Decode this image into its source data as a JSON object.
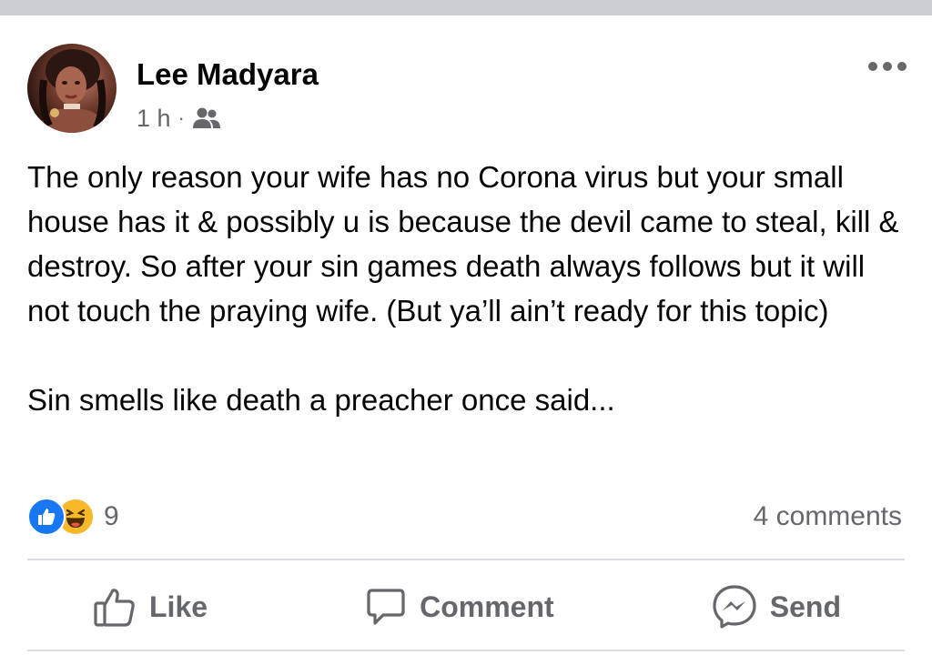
{
  "post": {
    "author": "Lee Madyara",
    "time": "1 h",
    "separator": "·",
    "audience_icon": "friends-icon",
    "more_icon": "more-horizontal-icon",
    "body": [
      "The only reason your wife has no Corona virus but your small house has it & possibly u is because the devil came to steal, kill & destroy. So after your sin games death always follows but it will not touch the praying wife. (But ya’ll ain’t ready for this topic)",
      "Sin smells like death a preacher once said..."
    ]
  },
  "engagement": {
    "reaction_icons": [
      "like-reaction-icon",
      "haha-reaction-icon"
    ],
    "reaction_count": "9",
    "comments": "4 comments"
  },
  "actions": {
    "like_label": "Like",
    "comment_label": "Comment",
    "send_label": "Send"
  },
  "colors": {
    "text": "#050505",
    "secondary_text": "#65676b",
    "like_blue": "#1877f2",
    "haha_yellow": "#f7b928",
    "divider": "#dadde1",
    "top_bar": "#ccced3"
  }
}
